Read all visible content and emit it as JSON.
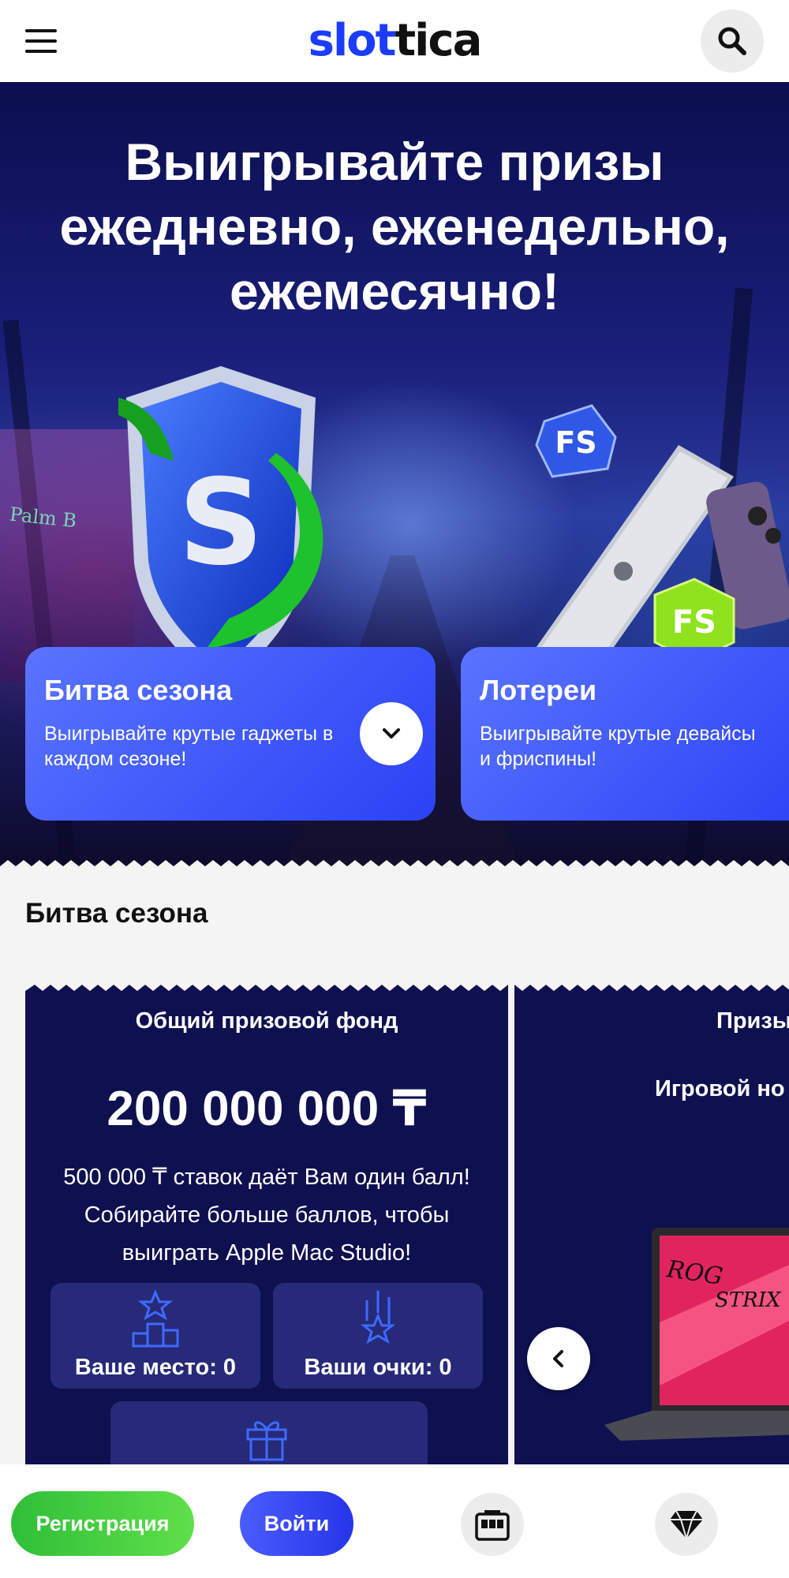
{
  "header": {
    "logo_part1": "slot",
    "logo_part2": "tica",
    "menu_icon": "hamburger-menu-icon",
    "search_icon": "search-icon",
    "accent_color": "#1b3cff"
  },
  "hero": {
    "title_line1": "Выигрывайте призы",
    "title_line2": "ежедневно, еженедельно,",
    "title_line3": "ежемесячно!",
    "sign_text": "Palm B",
    "gem_label_1": "FS",
    "gem_label_2": "FS",
    "shield_letter": "S",
    "promos": [
      {
        "title": "Битва сезона",
        "text": "Выигрывайте крутые гаджеты в каждом сезоне!"
      },
      {
        "title": "Лотереи",
        "text": "Выигрывайте крутые девайсы и фриспины!"
      }
    ]
  },
  "section": {
    "title": "Битва сезона",
    "card1": {
      "heading": "Общий призовой фонд",
      "amount": "200 000 000 ₸",
      "description": "500 000 ₸ ставок даёт Вам один балл! Собирайте больше баллов, чтобы выиграть Apple Mac Studio!",
      "place_label": "Ваше место: 0",
      "points_label": "Ваши очки: 0"
    },
    "card2": {
      "heading": "Призы",
      "subheading": "Игровой но",
      "laptop_brand_1": "ROG",
      "laptop_brand_2": "STRIX"
    }
  },
  "bottom_bar": {
    "register_label": "Регистрация",
    "login_label": "Войти",
    "slots_icon": "slot-machine-icon",
    "vip_icon": "diamond-icon",
    "register_color": "#2fbf38",
    "login_color": "#2636e8"
  }
}
